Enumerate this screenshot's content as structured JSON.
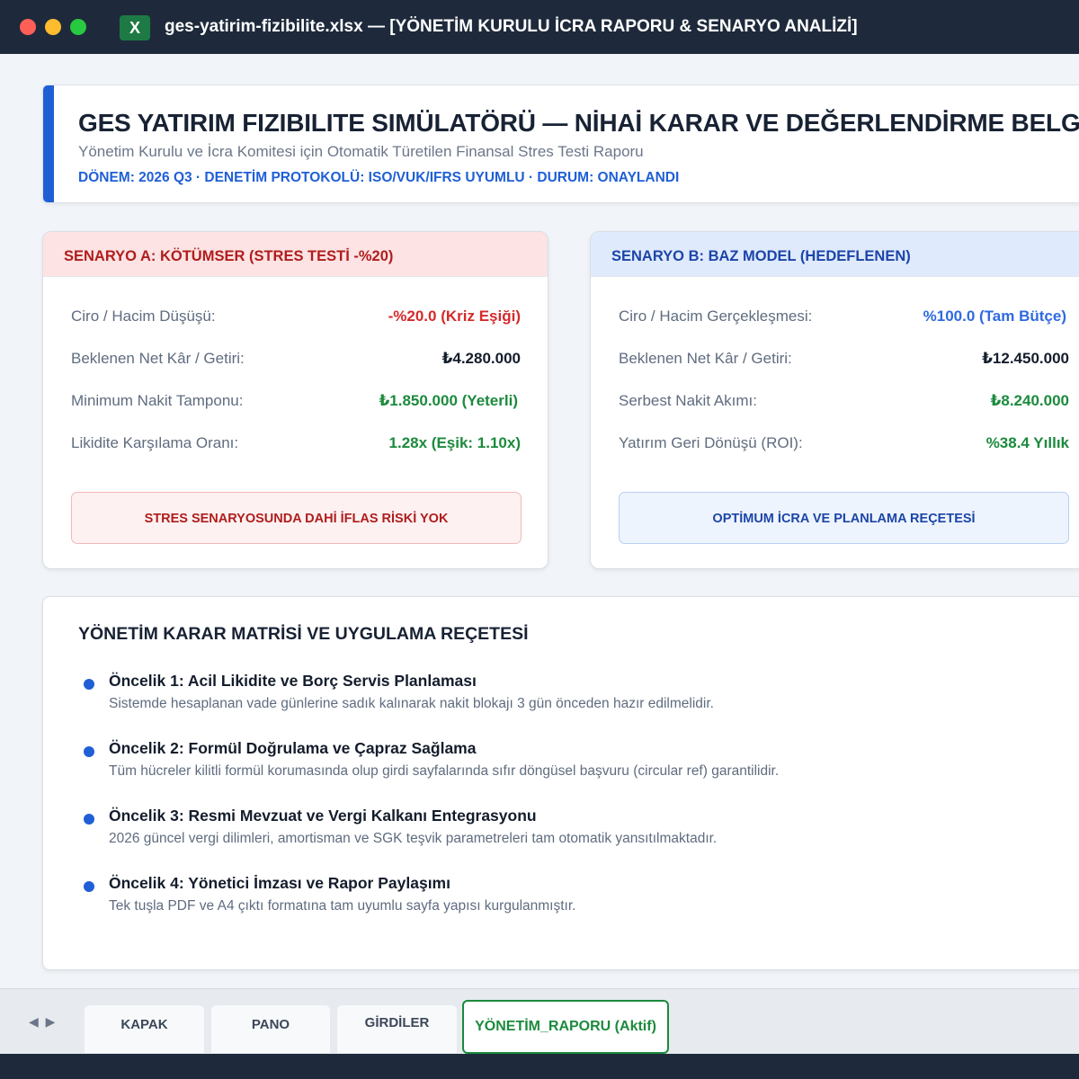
{
  "window": {
    "title": "ges-yatirim-fizibilite.xlsx — [YÖNETİM KURULU İCRA RAPORU & SENARYO ANALİZİ]",
    "app_icon": "excel-icon",
    "app_icon_glyph": "X",
    "accent_color": "#1d7a45"
  },
  "header": {
    "title": "GES YATIRIM FIZIBILITE SIMÜLATÖRÜ — NİHAİ KARAR VE DEĞERLENDİRME BELGESİ",
    "subtitle": "Yönetim Kurulu ve İcra Komitesi için Otomatik Türetilen Finansal Stres Testi Raporu",
    "meta": "DÖNEM: 2026 Q3 · DENETİM PROTOKOLÜ: ISO/VUK/IFRS UYUMLU · DURUM: ONAYLANDI",
    "accent_color": "#1f5fd6"
  },
  "scenario_a": {
    "title": "SENARYO A: KÖTÜMSER (STRES TESTİ -%20)",
    "metrics": [
      {
        "label": "Ciro / Hacim Düşüşü:",
        "value": "-%20.0 (Kriz Eşiği)"
      },
      {
        "label": "Beklenen Net Kâr / Getiri:",
        "value": "₺4.280.000"
      },
      {
        "label": "Minimum Nakit Tamponu:",
        "value": "₺1.850.000 (Yeterli)"
      },
      {
        "label": "Likidite Karşılama Oranı:",
        "value": "1.28x (Eşik: 1.10x)"
      }
    ],
    "button": "STRES SENARYOSUNDA DAHİ İFLAS RİSKİ YOK",
    "color": "#b01d1d"
  },
  "scenario_b": {
    "title": "SENARYO B: BAZ MODEL (HEDEFLENEN)",
    "metrics": [
      {
        "label": "Ciro / Hacim Gerçekleşmesi:",
        "value": "%100.0 (Tam Bütçe)"
      },
      {
        "label": "Beklenen Net Kâr / Getiri:",
        "value": "₺12.450.000"
      },
      {
        "label": "Serbest Nakit Akımı:",
        "value": "₺8.240.000"
      },
      {
        "label": "Yatırım Geri Dönüşü (ROI):",
        "value": "%38.4 Yıllık"
      }
    ],
    "button": "OPTİMUM İCRA VE PLANLAMA REÇETESİ",
    "color": "#1c45a8"
  },
  "matrix": {
    "title": "YÖNETİM KARAR MATRİSİ VE UYGULAMA REÇETESİ",
    "items": [
      {
        "title": "Öncelik 1: Acil Likidite ve Borç Servis Planlaması",
        "desc": "Sistemde hesaplanan vade günlerine sadık kalınarak nakit blokajı 3 gün önceden hazır edilmelidir."
      },
      {
        "title": "Öncelik 2: Formül Doğrulama ve Çapraz Sağlama",
        "desc": "Tüm hücreler kilitli formül korumasında olup girdi sayfalarında sıfır döngüsel başvuru (circular ref) garantilidir."
      },
      {
        "title": "Öncelik 3: Resmi Mevzuat ve Vergi Kalkanı Entegrasyonu",
        "desc": "2026 güncel vergi dilimleri, amortisman ve SGK teşvik parametreleri tam otomatik yansıtılmaktadır."
      },
      {
        "title": "Öncelik 4: Yönetici İmzası ve Rapor Paylaşımı",
        "desc": "Tek tuşla PDF ve A4 çıktı formatına tam uyumlu sayfa yapısı kurgulanmıştır."
      }
    ]
  },
  "tabs": {
    "nav_glyph": "◀ ▶",
    "items": [
      {
        "label": "KAPAK"
      },
      {
        "label": "PANO"
      },
      {
        "label": "GİRDİLER"
      },
      {
        "label": "YÖNETİM_RAPORU (Aktif)"
      }
    ],
    "active_color": "#1c8a3d"
  }
}
